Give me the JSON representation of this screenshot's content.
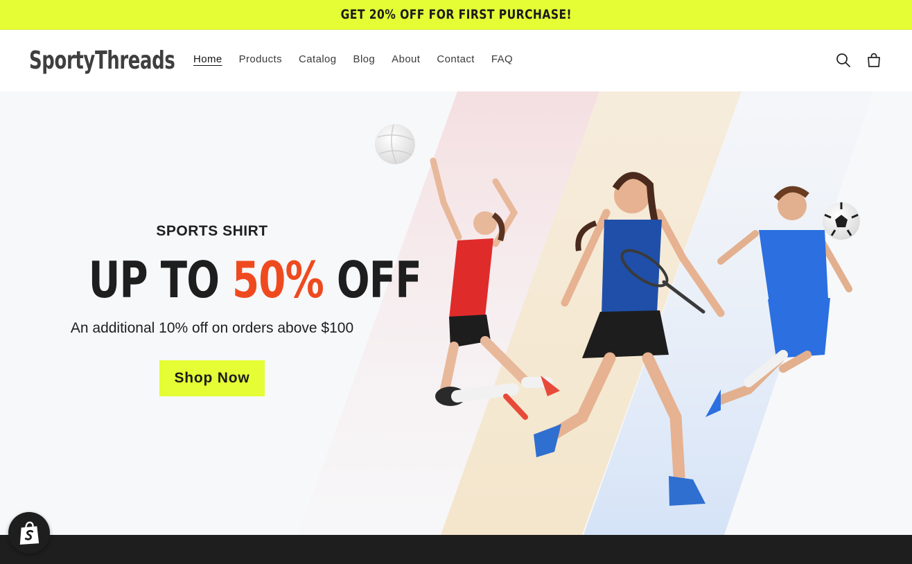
{
  "announcement": {
    "text": "GET 20% OFF FOR FIRST PURCHASE!"
  },
  "header": {
    "logo": "SportyThreads",
    "nav": [
      {
        "label": "Home",
        "active": true
      },
      {
        "label": "Products"
      },
      {
        "label": "Catalog"
      },
      {
        "label": "Blog"
      },
      {
        "label": "About"
      },
      {
        "label": "Contact"
      },
      {
        "label": "FAQ"
      }
    ],
    "icons": [
      "search-icon",
      "cart-icon"
    ]
  },
  "hero": {
    "eyebrow": "SPORTS SHIRT",
    "headline_prefix": "UP TO ",
    "headline_accent": "50%",
    "headline_suffix": " OFF",
    "subline": "An additional 10% off on orders above $100",
    "cta_label": "Shop Now",
    "colors": {
      "accent": "#ef4a1f",
      "brand": "#e4fd35"
    }
  },
  "widgets": {
    "shopify_badge": "shopify-bag-icon"
  }
}
